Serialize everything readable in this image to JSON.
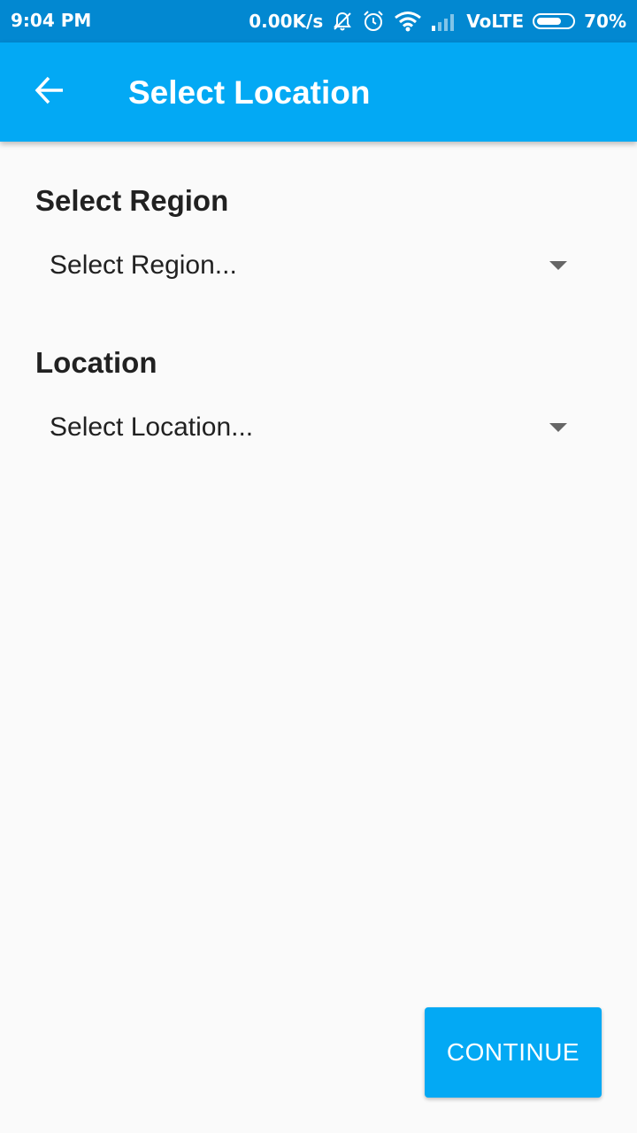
{
  "status_bar": {
    "time": "9:04 PM",
    "network_speed": "0.00K/s",
    "network_type": "VoLTE",
    "battery": "70%",
    "battery_level": 0.7,
    "icons": [
      "bell-off-icon",
      "alarm-icon",
      "wifi-icon",
      "signal-icon",
      "battery-icon"
    ]
  },
  "app_bar": {
    "title": "Select Location",
    "back_icon": "arrow-back-icon",
    "color": "#03a9f4"
  },
  "form": {
    "region": {
      "label": "Select Region",
      "selected_value": "Select Region..."
    },
    "location": {
      "label": "Location",
      "selected_value": "Select Location..."
    }
  },
  "actions": {
    "continue_label": "CONTINUE"
  },
  "colors": {
    "primary": "#03a9f4",
    "primary_dark": "#0288d1",
    "background": "#fafafa",
    "text": "#212121"
  }
}
